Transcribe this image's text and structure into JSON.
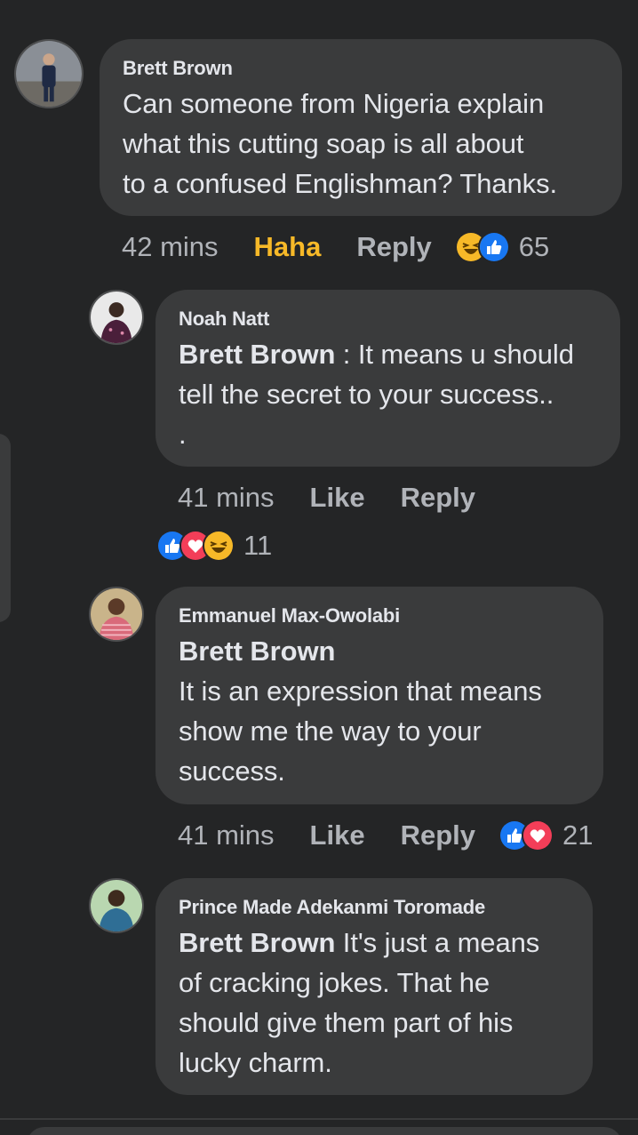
{
  "comments": [
    {
      "author": "Brett Brown",
      "mention": "",
      "text": "Can someone from Nigeria explain\nwhat this cutting soap is all about\nto a confused Englishman? Thanks.",
      "time": "42 mins",
      "action1": "Haha",
      "action2": "Reply",
      "reactions": [
        "haha-icon",
        "like-icon"
      ],
      "reaction_count": "65"
    },
    {
      "author": "Noah Natt",
      "mention": "Brett Brown",
      "text": " : It means u should\ntell the secret to your success..\n.",
      "time": "41 mins",
      "action1": "Like",
      "action2": "Reply",
      "reactions": [
        "like-icon",
        "love-icon",
        "haha-icon"
      ],
      "reaction_count": "11"
    },
    {
      "author": "Emmanuel Max-Owolabi",
      "mention": "Brett Brown",
      "text": "\nIt is an expression that means\nshow me the way to your\nsuccess.",
      "time": "41 mins",
      "action1": "Like",
      "action2": "Reply",
      "reactions": [
        "like-icon",
        "love-icon"
      ],
      "reaction_count": "21"
    },
    {
      "author": "Prince Made Adekanmi Toromade",
      "mention": "Brett Brown",
      "text": "  It's just a means\nof cracking jokes. That he\nshould give them part of his\nlucky charm.",
      "time": "",
      "action1": "",
      "action2": "",
      "reactions": [],
      "reaction_count": ""
    }
  ],
  "colors": {
    "background": "#242526",
    "bubble": "#3a3b3c",
    "text": "#e4e6eb",
    "meta": "#b0b3b8",
    "haha_active": "#f7b928",
    "like_blue": "#1877f2",
    "love_red": "#f33e58"
  }
}
